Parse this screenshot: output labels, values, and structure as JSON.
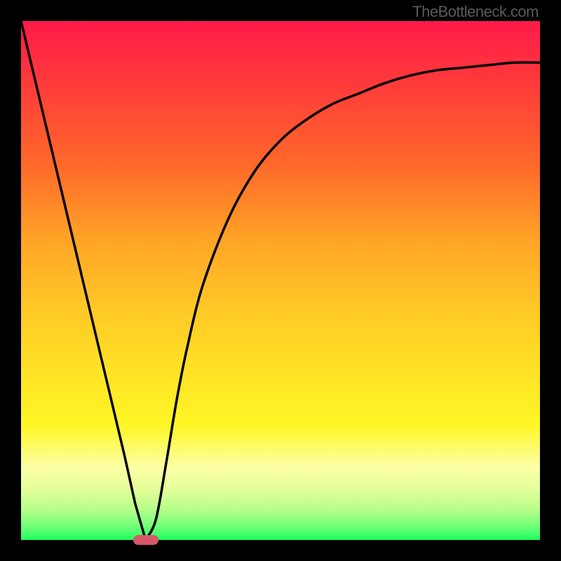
{
  "watermark": "TheBottleneck.com",
  "chart_data": {
    "type": "line",
    "title": "",
    "xlabel": "",
    "ylabel": "",
    "xlim": [
      0,
      100
    ],
    "ylim": [
      0,
      100
    ],
    "grid": false,
    "legend": false,
    "axes_visible": false,
    "background_gradient": {
      "direction": "vertical",
      "stops": [
        {
          "pos": 0,
          "color": "#ff1a4a"
        },
        {
          "pos": 12,
          "color": "#ff3a3a"
        },
        {
          "pos": 28,
          "color": "#ff6a2a"
        },
        {
          "pos": 42,
          "color": "#ffa326"
        },
        {
          "pos": 55,
          "color": "#ffc726"
        },
        {
          "pos": 68,
          "color": "#ffe326"
        },
        {
          "pos": 78,
          "color": "#fff726"
        },
        {
          "pos": 86,
          "color": "#fcffa6"
        },
        {
          "pos": 90,
          "color": "#e6ff9a"
        },
        {
          "pos": 94,
          "color": "#b8ff8a"
        },
        {
          "pos": 97,
          "color": "#7aff7a"
        },
        {
          "pos": 99,
          "color": "#3fff6a"
        },
        {
          "pos": 100,
          "color": "#1aff5a"
        }
      ]
    },
    "series": [
      {
        "name": "bottleneck-curve",
        "color": "#000000",
        "x": [
          0,
          5,
          10,
          15,
          20,
          22,
          24,
          26,
          28,
          30,
          32,
          35,
          40,
          45,
          50,
          55,
          60,
          65,
          70,
          75,
          80,
          85,
          90,
          95,
          100
        ],
        "y": [
          100,
          79,
          58,
          37,
          16,
          7,
          0,
          4,
          15,
          27,
          37,
          49,
          62,
          71,
          77,
          81,
          84,
          86,
          88,
          89.5,
          90.5,
          91,
          91.5,
          92,
          92
        ]
      }
    ],
    "marker": {
      "x": 24,
      "y": 0,
      "color": "#d9576a",
      "shape": "rounded-rect"
    }
  }
}
